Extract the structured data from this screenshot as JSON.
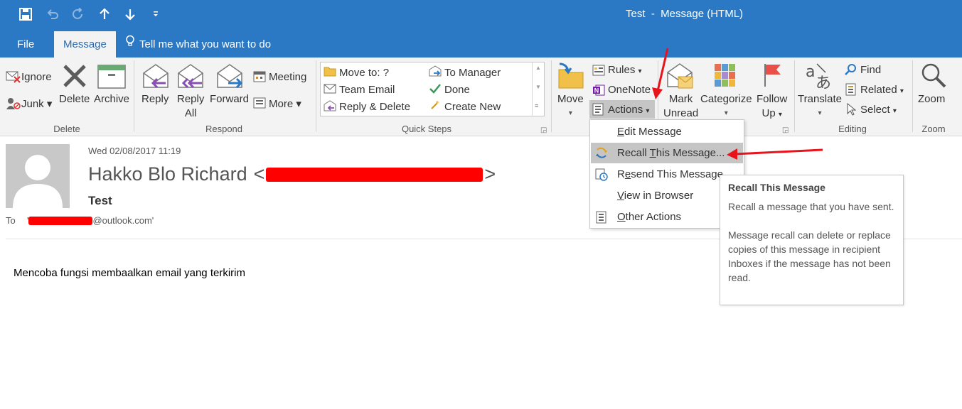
{
  "window": {
    "title": "Test  -  Message (HTML)"
  },
  "quick_access": {
    "items": [
      {
        "name": "save-icon",
        "glyph": "🖫",
        "disabled": false
      },
      {
        "name": "undo-icon",
        "glyph": "↶",
        "disabled": true
      },
      {
        "name": "redo-icon",
        "glyph": "↻",
        "disabled": true
      },
      {
        "name": "up-arrow-icon",
        "glyph": "↑",
        "disabled": false
      },
      {
        "name": "down-arrow-icon",
        "glyph": "↓",
        "disabled": false
      },
      {
        "name": "customize-qat-icon",
        "glyph": "⌄",
        "disabled": false
      }
    ]
  },
  "tabs": {
    "file": "File",
    "message": "Message",
    "tell_me": "Tell me what you want to do"
  },
  "ribbon": {
    "delete_group": {
      "label": "Delete",
      "ignore": "Ignore",
      "junk": "Junk",
      "delete": "Delete",
      "archive": "Archive"
    },
    "respond_group": {
      "label": "Respond",
      "reply": "Reply",
      "reply_all_1": "Reply",
      "reply_all_2": "All",
      "forward": "Forward",
      "meeting": "Meeting",
      "more": "More"
    },
    "quick_steps": {
      "label": "Quick Steps",
      "move_to": "Move to: ?",
      "team_email": "Team Email",
      "reply_delete": "Reply & Delete",
      "to_manager": "To Manager",
      "done": "Done",
      "create_new": "Create New"
    },
    "move_group": {
      "move": "Move",
      "rules": "Rules",
      "onenote": "OneNote",
      "actions": "Actions"
    },
    "tags_group": {
      "mark_unread_1": "Mark",
      "mark_unread_2": "Unread",
      "categorize": "Categorize",
      "follow_up_1": "Follow",
      "follow_up_2": "Up"
    },
    "editing_group": {
      "label": "Editing",
      "translate": "Translate",
      "find": "Find",
      "related": "Related",
      "select": "Select"
    },
    "zoom_group": {
      "label": "Zoom",
      "zoom": "Zoom"
    }
  },
  "message": {
    "date": "Wed 02/08/2017 11:19",
    "sender_name": "Hakko Blo Richard",
    "subject": "Test",
    "to_label": "To",
    "to_quote_open": "'",
    "to_domain": "@outlook.com'",
    "body": "Mencoba fungsi membaalkan email yang terkirim"
  },
  "actions_menu": {
    "items": [
      {
        "name": "menu-item-edit-message",
        "pre": "",
        "u": "E",
        "post": "dit Message",
        "highlighted": false
      },
      {
        "name": "menu-item-recall-this-message",
        "pre": "Recall ",
        "u": "T",
        "post": "his Message...",
        "highlighted": true
      },
      {
        "name": "menu-item-resend-this-message",
        "pre": "R",
        "u": "e",
        "post": "send This Message...",
        "highlighted": false
      },
      {
        "name": "menu-item-view-in-browser",
        "pre": "",
        "u": "V",
        "post": "iew in Browser",
        "highlighted": false
      },
      {
        "name": "menu-item-other-actions",
        "pre": "",
        "u": "O",
        "post": "ther Actions",
        "highlighted": false
      }
    ]
  },
  "tooltip": {
    "title": "Recall This Message",
    "line1": "Recall a message that you have sent.",
    "line2": "Message recall can delete or replace copies of this message in recipient Inboxes if the message has not been read."
  },
  "colors": {
    "title_bar": "#2b78c5",
    "ribbon": "#f3f3f3",
    "redaction": "#ff0000",
    "annotation_arrow": "#e8141c"
  }
}
